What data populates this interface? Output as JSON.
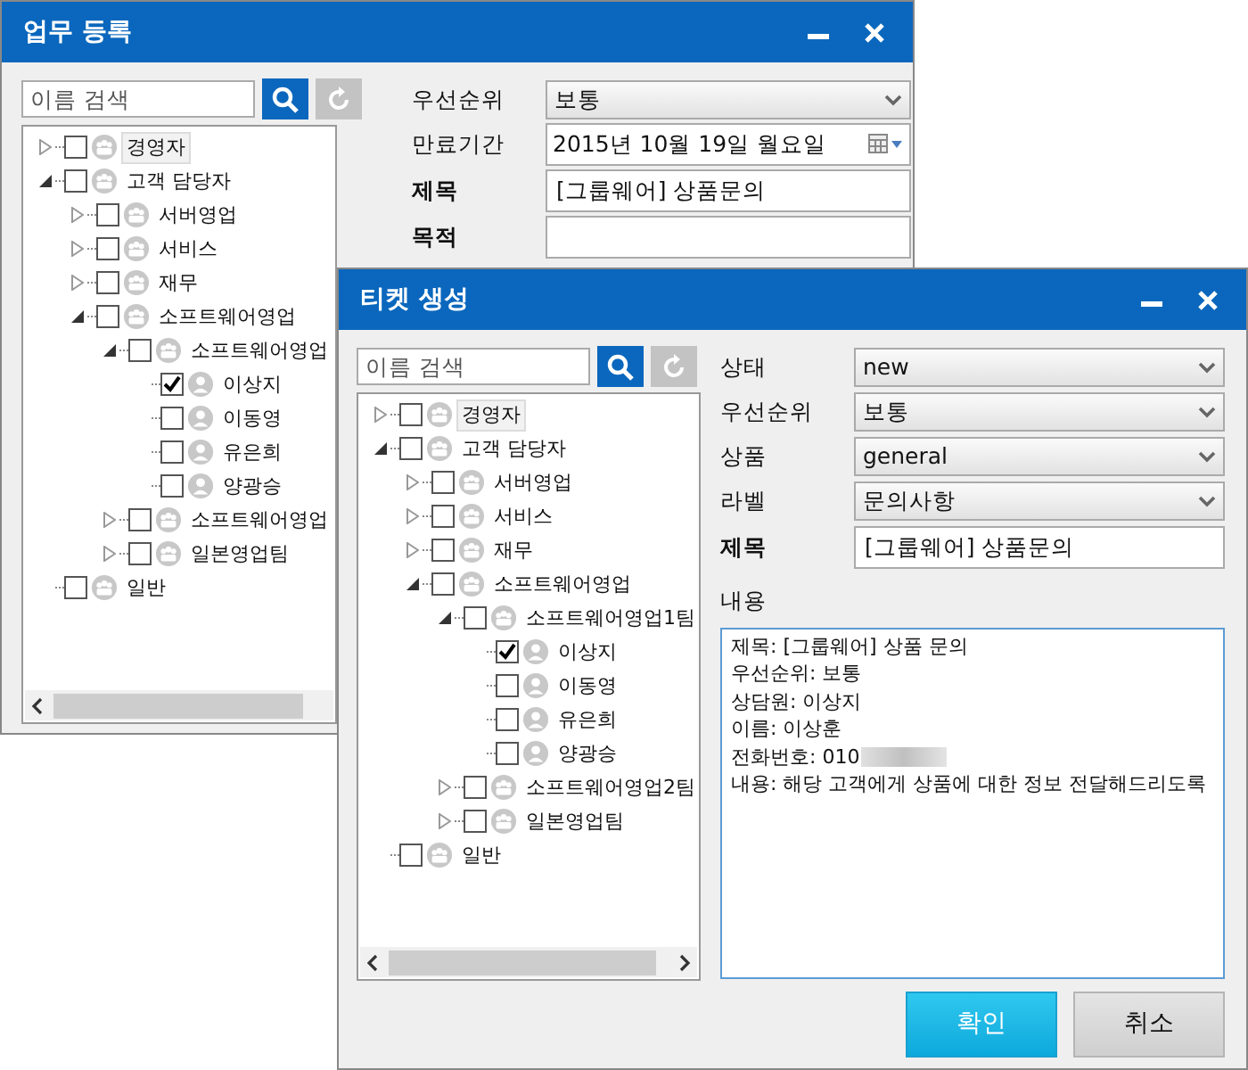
{
  "back_window": {
    "title": "업무 등록",
    "search": {
      "placeholder": "이름 검색"
    },
    "tree": [
      {
        "label": "경영자",
        "kind": "group",
        "expanded": false,
        "checked": false,
        "selected": true
      },
      {
        "label": "고객 담당자",
        "kind": "group",
        "expanded": true,
        "checked": false,
        "selected": false,
        "children": [
          {
            "label": "서버영업",
            "kind": "group",
            "expanded": false,
            "checked": false,
            "selected": false
          },
          {
            "label": "서비스",
            "kind": "group",
            "expanded": false,
            "checked": false,
            "selected": false
          },
          {
            "label": "재무",
            "kind": "group",
            "expanded": false,
            "checked": false,
            "selected": false
          },
          {
            "label": "소프트웨어영업",
            "kind": "group",
            "expanded": true,
            "checked": false,
            "selected": false,
            "children": [
              {
                "label": "소프트웨어영업",
                "kind": "group",
                "expanded": true,
                "checked": false,
                "selected": false,
                "children": [
                  {
                    "label": "이상지",
                    "kind": "person",
                    "checked": true,
                    "selected": false
                  },
                  {
                    "label": "이동영",
                    "kind": "person",
                    "checked": false,
                    "selected": false
                  },
                  {
                    "label": "유은희",
                    "kind": "person",
                    "checked": false,
                    "selected": false
                  },
                  {
                    "label": "양광승",
                    "kind": "person",
                    "checked": false,
                    "selected": false
                  }
                ]
              },
              {
                "label": "소프트웨어영업",
                "kind": "group",
                "expanded": false,
                "checked": false,
                "selected": false
              },
              {
                "label": "일본영업팀",
                "kind": "group",
                "expanded": false,
                "checked": false,
                "selected": false
              }
            ]
          }
        ]
      },
      {
        "label": "일반",
        "kind": "group",
        "checked": false,
        "selected": false
      }
    ],
    "fields": [
      {
        "label": "우선순위",
        "kind": "select",
        "value": "보통"
      },
      {
        "label": "만료기간",
        "kind": "date",
        "value": "2015년 10월 19일 월요일"
      },
      {
        "label": "제목",
        "kind": "text",
        "value": "[그룹웨어] 상품문의"
      },
      {
        "label": "목적",
        "kind": "text"
      }
    ]
  },
  "front_window": {
    "title": "티켓 생성",
    "search": {
      "placeholder": "이름 검색"
    },
    "tree": [
      {
        "label": "경영자",
        "kind": "group",
        "expanded": false,
        "checked": false,
        "selected": true
      },
      {
        "label": "고객 담당자",
        "kind": "group",
        "expanded": true,
        "checked": false,
        "selected": false,
        "children": [
          {
            "label": "서버영업",
            "kind": "group",
            "expanded": false,
            "checked": false,
            "selected": false
          },
          {
            "label": "서비스",
            "kind": "group",
            "expanded": false,
            "checked": false,
            "selected": false
          },
          {
            "label": "재무",
            "kind": "group",
            "expanded": false,
            "checked": false,
            "selected": false
          },
          {
            "label": "소프트웨어영업",
            "kind": "group",
            "expanded": true,
            "checked": false,
            "selected": false,
            "children": [
              {
                "label": "소프트웨어영업1팀",
                "kind": "group",
                "expanded": true,
                "checked": false,
                "selected": false,
                "children": [
                  {
                    "label": "이상지",
                    "kind": "person",
                    "checked": true,
                    "selected": false
                  },
                  {
                    "label": "이동영",
                    "kind": "person",
                    "checked": false,
                    "selected": false
                  },
                  {
                    "label": "유은희",
                    "kind": "person",
                    "checked": false,
                    "selected": false
                  },
                  {
                    "label": "양광승",
                    "kind": "person",
                    "checked": false,
                    "selected": false
                  }
                ]
              },
              {
                "label": "소프트웨어영업2팀",
                "kind": "group",
                "expanded": false,
                "checked": false,
                "selected": false
              },
              {
                "label": "일본영업팀",
                "kind": "group",
                "expanded": false,
                "checked": false,
                "selected": false
              }
            ]
          }
        ]
      },
      {
        "label": "일반",
        "kind": "group",
        "checked": false,
        "selected": false
      }
    ],
    "fields": [
      {
        "label": "상태",
        "kind": "select",
        "value": "new"
      },
      {
        "label": "우선순위",
        "kind": "select",
        "value": "보통"
      },
      {
        "label": "상품",
        "kind": "select",
        "value": "general"
      },
      {
        "label": "라벨",
        "kind": "select",
        "value": "문의사항"
      },
      {
        "label": "제목",
        "kind": "text",
        "value": "[그룹웨어] 상품문의"
      }
    ],
    "content": {
      "label": "내용",
      "lines": [
        {
          "text": "제목: [그룹웨어] 상품 문의",
          "redacted": false
        },
        {
          "text": "우선순위: 보통",
          "redacted": false
        },
        {
          "text": "상담원: 이상지",
          "redacted": false
        },
        {
          "text": "이름: 이상훈",
          "redacted": false
        },
        {
          "text": "전화번호: 010",
          "redacted": true
        },
        {
          "text": "내용: 해당 고객에게 상품에 대한 정보 전달해드리도록",
          "redacted": false
        }
      ]
    },
    "buttons": [
      {
        "label": "확인",
        "kind": "primary"
      },
      {
        "label": "취소",
        "kind": "secondary"
      }
    ]
  }
}
